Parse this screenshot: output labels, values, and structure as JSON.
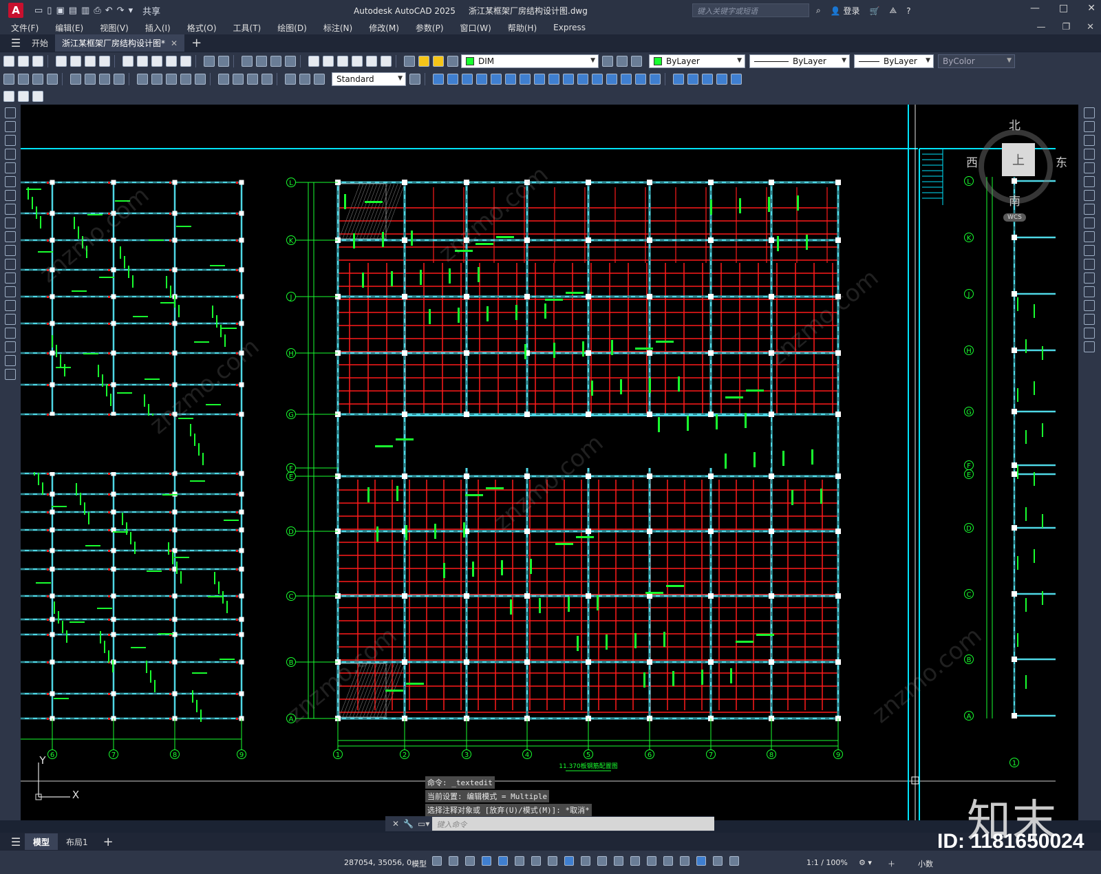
{
  "titlebar": {
    "app_title": "Autodesk AutoCAD 2025",
    "file_title": "浙江某框架厂房结构设计图.dwg",
    "share": "共享",
    "search_placeholder": "键入关键字或短语",
    "login": "登录"
  },
  "menu": [
    "文件(F)",
    "编辑(E)",
    "视图(V)",
    "插入(I)",
    "格式(O)",
    "工具(T)",
    "绘图(D)",
    "标注(N)",
    "修改(M)",
    "参数(P)",
    "窗口(W)",
    "帮助(H)",
    "Express"
  ],
  "tabs": {
    "start": "开始",
    "active": "浙江某框架厂房结构设计图*"
  },
  "toolbar": {
    "layer": "DIM",
    "color": "ByLayer",
    "linetype": "ByLayer",
    "lineweight": "ByLayer",
    "plotstyle": "ByColor",
    "dimstyle": "Standard"
  },
  "viewcube": {
    "north": "北",
    "south": "南",
    "west": "西",
    "east": "东",
    "top": "上",
    "wcs": "WCS"
  },
  "drawing": {
    "rows_main": [
      "L",
      "K",
      "J",
      "H",
      "G",
      "F",
      "E",
      "D",
      "C",
      "B",
      "A"
    ],
    "cols_main": [
      "1",
      "2",
      "3",
      "4",
      "5",
      "6",
      "7",
      "8",
      "9"
    ],
    "cols_left": [
      "6",
      "7",
      "8",
      "9"
    ],
    "rows_right": [
      "L",
      "K",
      "J",
      "H",
      "G",
      "F",
      "E",
      "D",
      "C",
      "B",
      "A"
    ],
    "col_right": "1",
    "caption": "11.370板钢筋配置图",
    "ucs_y": "Y",
    "ucs_x": "X"
  },
  "command": {
    "history": [
      "命令: _textedit",
      "当前设置: 编辑模式 = Multiple",
      "选择注释对象或 [放弃(U)/模式(M)]: *取消*"
    ],
    "placeholder": "键入命令"
  },
  "layout_tabs": {
    "model": "模型",
    "layout1": "布局1"
  },
  "status": {
    "coords": "287054, 35056, 0",
    "mode": "模型",
    "scale": "1:1 / 100%",
    "units": "小数"
  },
  "watermark": {
    "brand": "知末",
    "id": "ID: 1181650024",
    "diagonal": "znzmo.com"
  },
  "colors": {
    "grid_cyan": "#4fd8e6",
    "rebar_red": "#ff1a1a",
    "text_green": "#19ff2f",
    "node_white": "#ffffff",
    "border_cyan": "#00e5ff"
  }
}
